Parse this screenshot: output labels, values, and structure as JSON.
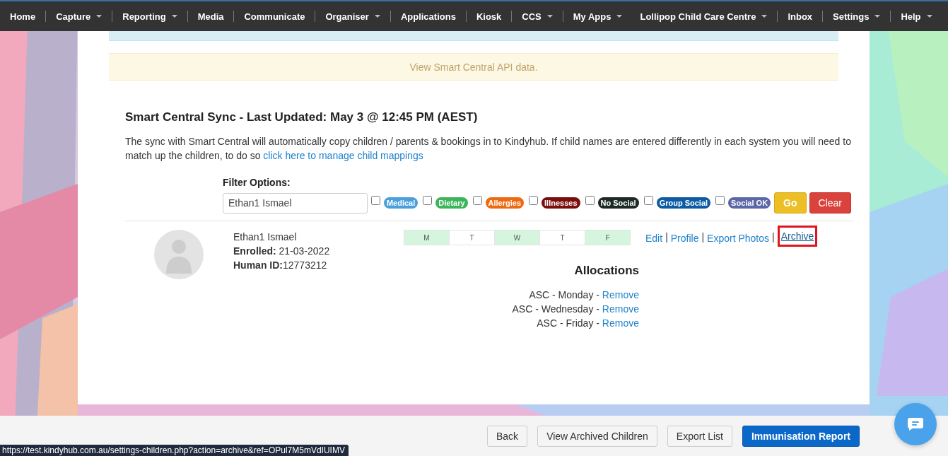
{
  "nav": [
    {
      "label": "Home",
      "dropdown": false
    },
    {
      "label": "Capture",
      "dropdown": true
    },
    {
      "label": "Reporting",
      "dropdown": true
    },
    {
      "label": "Media",
      "dropdown": false
    },
    {
      "label": "Communicate",
      "dropdown": false
    },
    {
      "label": "Organiser",
      "dropdown": true
    },
    {
      "label": "Applications",
      "dropdown": false
    },
    {
      "label": "Kiosk",
      "dropdown": false
    },
    {
      "label": "CCS",
      "dropdown": true
    },
    {
      "label": "My Apps",
      "dropdown": true
    },
    {
      "label": "Lollipop Child Care Centre",
      "dropdown": true,
      "no_divider": true
    },
    {
      "label": "Inbox",
      "dropdown": false
    },
    {
      "label": "Settings",
      "dropdown": true
    },
    {
      "label": "Help",
      "dropdown": true
    }
  ],
  "api_banner": {
    "text": "View Smart Central API data."
  },
  "sync": {
    "heading": "Smart Central Sync - Last Updated: May 3 @ 12:45 PM (AEST)",
    "description": "The sync with Smart Central will automatically copy children / parents & bookings in to Kindyhub. If child names are entered differently in each system you will need to match up the children, to do so",
    "link": "click here to manage child mappings"
  },
  "filter": {
    "label": "Filter Options:",
    "search": "Ethan1 Ismael",
    "tags": [
      {
        "label": "Medical",
        "color": "#4a9fdc",
        "checked": false
      },
      {
        "label": "Dietary",
        "color": "#3cb55a",
        "checked": false
      },
      {
        "label": "Allergies",
        "color": "#ee6a12",
        "checked": false
      },
      {
        "label": "Illnesses",
        "color": "#7b0d0d",
        "checked": false
      },
      {
        "label": "No Social",
        "color": "#1d2a25",
        "checked": false
      },
      {
        "label": "Group Social",
        "color": "#0d5ba3",
        "checked": false
      },
      {
        "label": "Social OK",
        "color": "#5b67a7",
        "checked": false
      }
    ],
    "buttons": [
      {
        "label": "Go",
        "kind": "warning"
      },
      {
        "label": "Clear",
        "kind": "danger"
      }
    ]
  },
  "child": {
    "name": "Ethan1 Ismael",
    "enrolled_label": "Enrolled:",
    "enrolled": "21-03-2022",
    "human_id_label": "Human ID:",
    "human_id": "12773212",
    "days": [
      {
        "label": "M",
        "booked": true
      },
      {
        "label": "T",
        "booked": false
      },
      {
        "label": "W",
        "booked": true
      },
      {
        "label": "T",
        "booked": false
      },
      {
        "label": "F",
        "booked": true
      }
    ],
    "actions": [
      {
        "label": "Edit",
        "highlighted": false
      },
      {
        "label": "Profile",
        "highlighted": false
      },
      {
        "label": "Export Photos",
        "highlighted": false
      },
      {
        "label": "Archive",
        "highlighted": true
      }
    ],
    "separator": "|",
    "allocations_title": "Allocations",
    "allocations": [
      {
        "text": "ASC - Monday - ",
        "action": "Remove"
      },
      {
        "text": "ASC - Wednesday - ",
        "action": "Remove"
      },
      {
        "text": "ASC - Friday - ",
        "action": "Remove"
      }
    ]
  },
  "footer_buttons": [
    {
      "label": "Back",
      "kind": "default"
    },
    {
      "label": "View Archived Children",
      "kind": "default"
    },
    {
      "label": "Export List",
      "kind": "default"
    },
    {
      "label": "Immunisation Report",
      "kind": "primary"
    }
  ],
  "status_url": "https://test.kindyhub.com.au/settings-children.php?action=archive&ref=OPul7M5mVdIUIMV"
}
